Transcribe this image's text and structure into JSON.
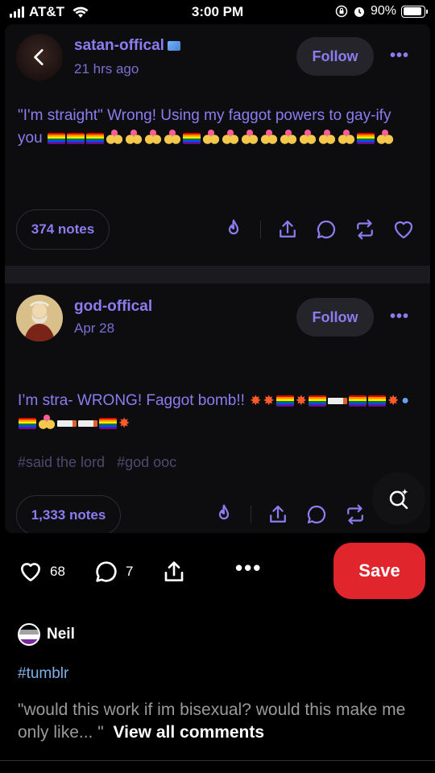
{
  "status_bar": {
    "carrier": "AT&T",
    "time": "3:00 PM",
    "battery_percent": "90%",
    "battery_level": 0.9
  },
  "post1": {
    "username": "satan-offical",
    "time": "21 hrs ago",
    "follow_label": "Follow",
    "more_label": "•••",
    "text": "\"I'm straight\" Wrong! Using my faggot powers to gay-ify you",
    "notes": "374 notes"
  },
  "post2": {
    "username": "god-offical",
    "time": "Apr 28",
    "follow_label": "Follow",
    "more_label": "•••",
    "text": "I’m stra- WRONG! Faggot bomb!!",
    "tags": [
      "#said the lord",
      "#god ooc"
    ],
    "notes": "1,333 notes"
  },
  "pin_actions": {
    "like_count": "68",
    "comment_count": "7",
    "more_label": "•••",
    "save_label": "Save"
  },
  "comment": {
    "author": "Neil",
    "hashtag": "#tumblr",
    "text": "\"would this work if im bisexual? would this make me only like... \"",
    "view_all": "View all comments"
  },
  "colors": {
    "accent_purple": "#8b7cf0",
    "save_red": "#e0262c",
    "hashtag_blue": "#7fb0e8"
  },
  "icons": [
    "back-arrow-icon",
    "fire-icon",
    "share-icon",
    "comment-icon",
    "reblog-icon",
    "heart-icon",
    "search-sparkle-icon",
    "signal-icon",
    "wifi-icon",
    "battery-icon"
  ]
}
